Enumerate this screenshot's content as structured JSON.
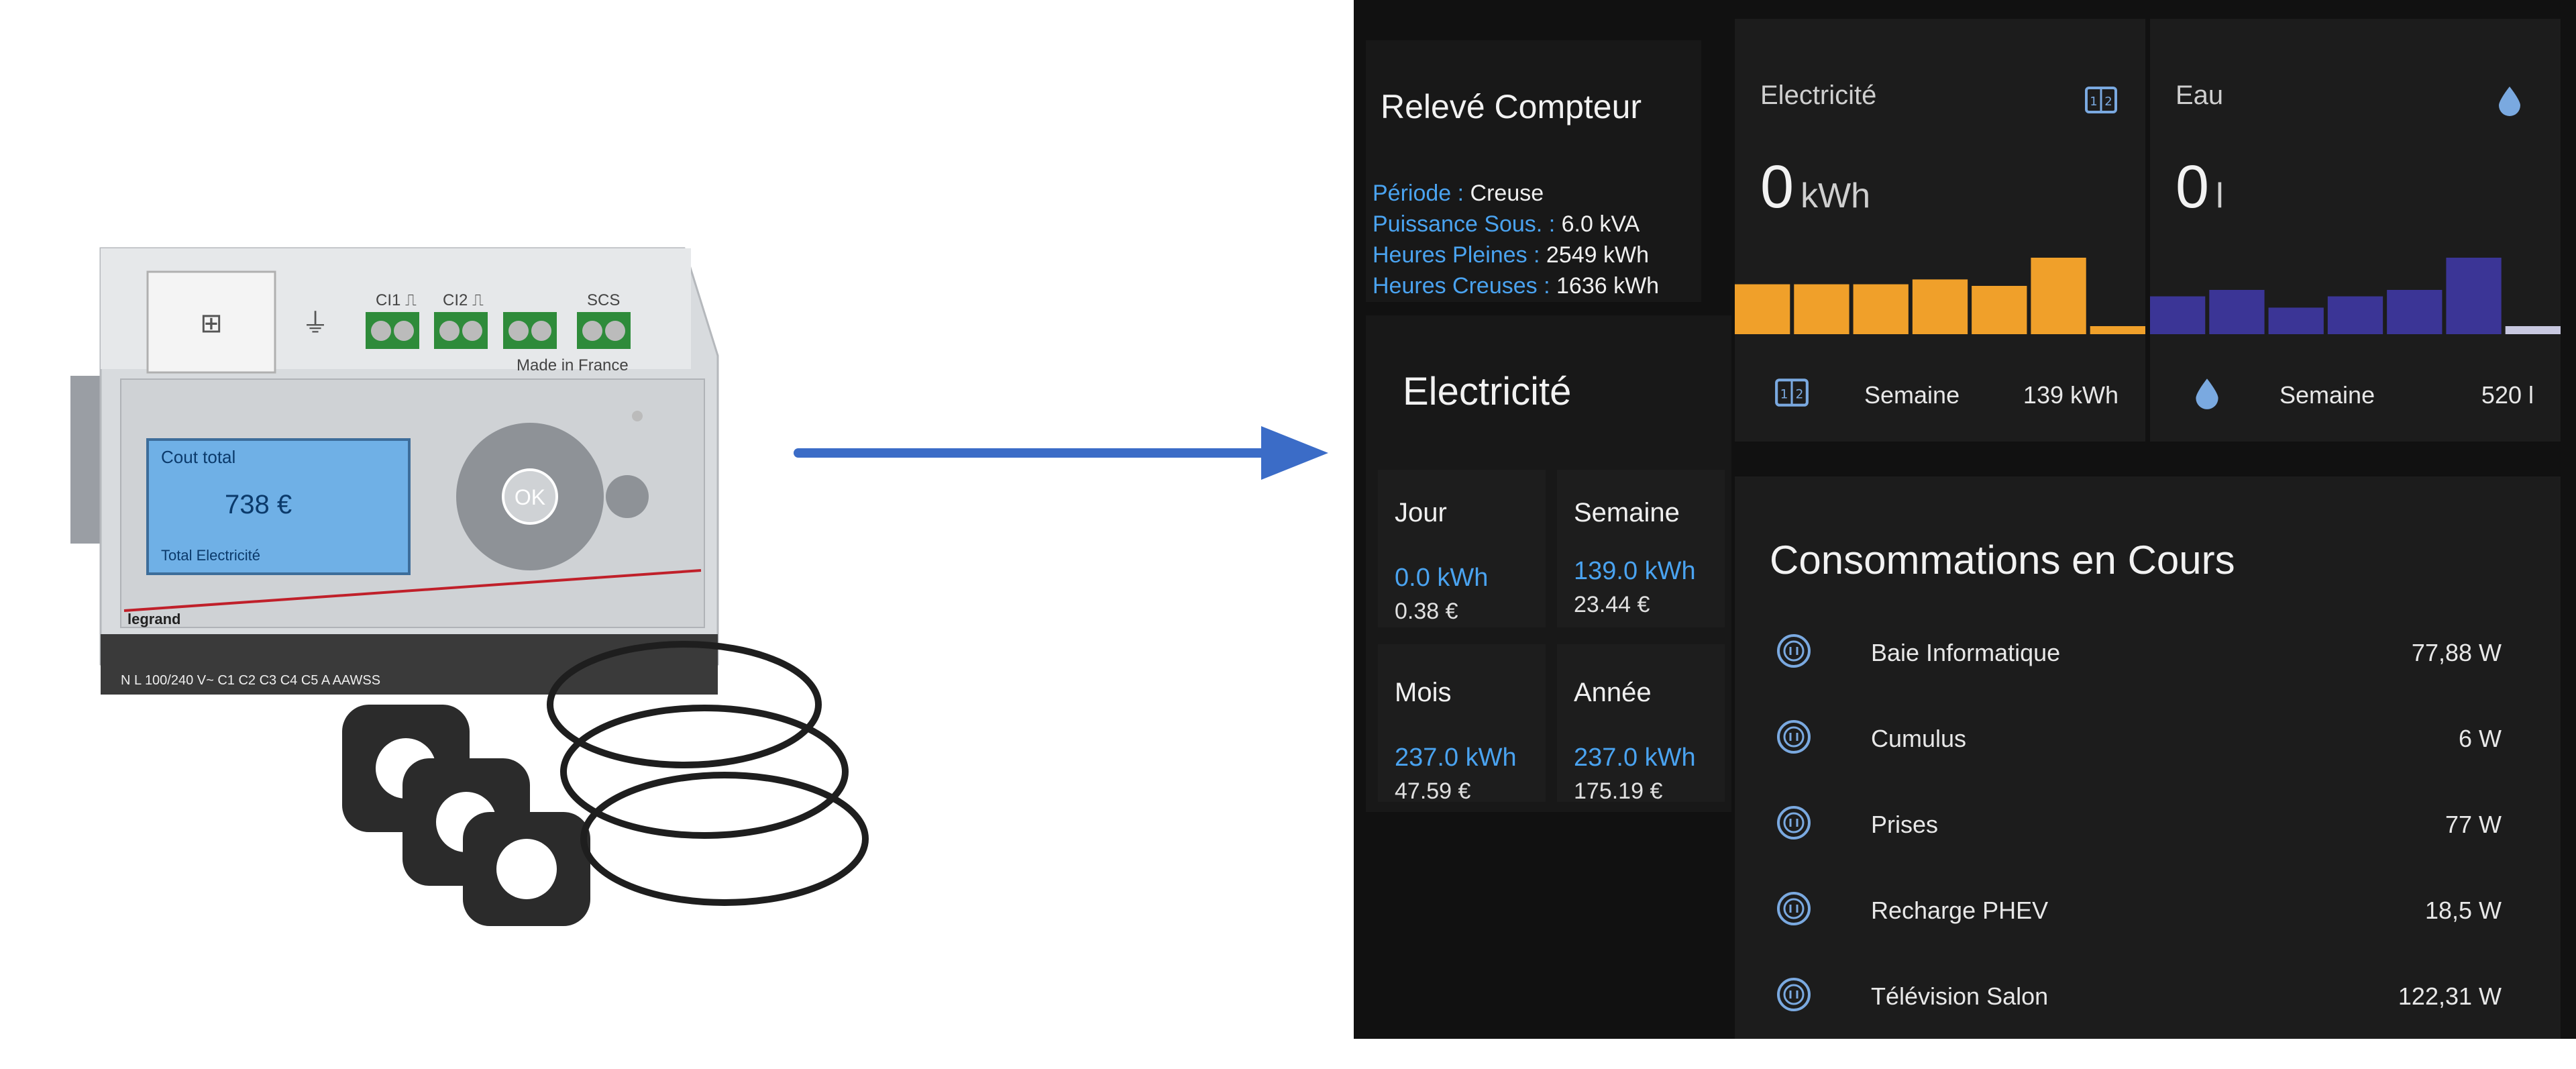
{
  "device": {
    "screen_line1": "Cout total",
    "screen_value": "738 €",
    "screen_line3": "Total Electricité",
    "ports": [
      "CI1 ⎍",
      "CI2 ⎍",
      "SCS"
    ],
    "made_in": "Made in France",
    "brand": "legrand",
    "terminals": "N  L  100/240 V~  C1   C2   C3   C4   C5      A AAWSS",
    "ok_label": "OK"
  },
  "releve": {
    "title": "Relevé Compteur",
    "periode_label": "Période :",
    "periode_value": "Creuse",
    "puissance_label": "Puissance Sous. :",
    "puissance_value": "6.0 kVA",
    "hp_label": "Heures Pleines :",
    "hp_value": "2549 kWh",
    "hc_label": "Heures Creuses :",
    "hc_value": "1636 kWh"
  },
  "electricite": {
    "title": "Electricité",
    "cells": [
      {
        "label": "Jour",
        "kwh": "0.0 kWh",
        "eur": "0.38 €"
      },
      {
        "label": "Semaine",
        "kwh": "139.0 kWh",
        "eur": "23.44 €"
      },
      {
        "label": "Mois",
        "kwh": "237.0 kWh",
        "eur": "47.59 €"
      },
      {
        "label": "Année",
        "kwh": "237.0 kWh",
        "eur": "175.19 €"
      }
    ]
  },
  "sensor_elec": {
    "name": "Electricité",
    "value": "0",
    "unit": "kWh",
    "icon": "meter-icon",
    "color": "#f0a02a",
    "bars": [
      0.62,
      0.62,
      0.62,
      0.68,
      0.6,
      0.95,
      0.1
    ],
    "footer_label": "Semaine",
    "footer_value": "139 kWh"
  },
  "sensor_eau": {
    "name": "Eau",
    "value": "0",
    "unit": "l",
    "icon": "water-drop-icon",
    "color": "#3b3596",
    "bars": [
      0.47,
      0.55,
      0.33,
      0.47,
      0.55,
      0.95,
      0.1
    ],
    "last_bar_color": "#c8c8e0",
    "footer_label": "Semaine",
    "footer_value": "520 l"
  },
  "conso": {
    "title": "Consommations en Cours",
    "items": [
      {
        "name": "Baie Informatique",
        "value": "77,88 W"
      },
      {
        "name": "Cumulus",
        "value": "6 W"
      },
      {
        "name": "Prises",
        "value": "77 W"
      },
      {
        "name": "Recharge PHEV",
        "value": "18,5 W"
      },
      {
        "name": "Télévision Salon",
        "value": "122,31 W"
      }
    ]
  }
}
